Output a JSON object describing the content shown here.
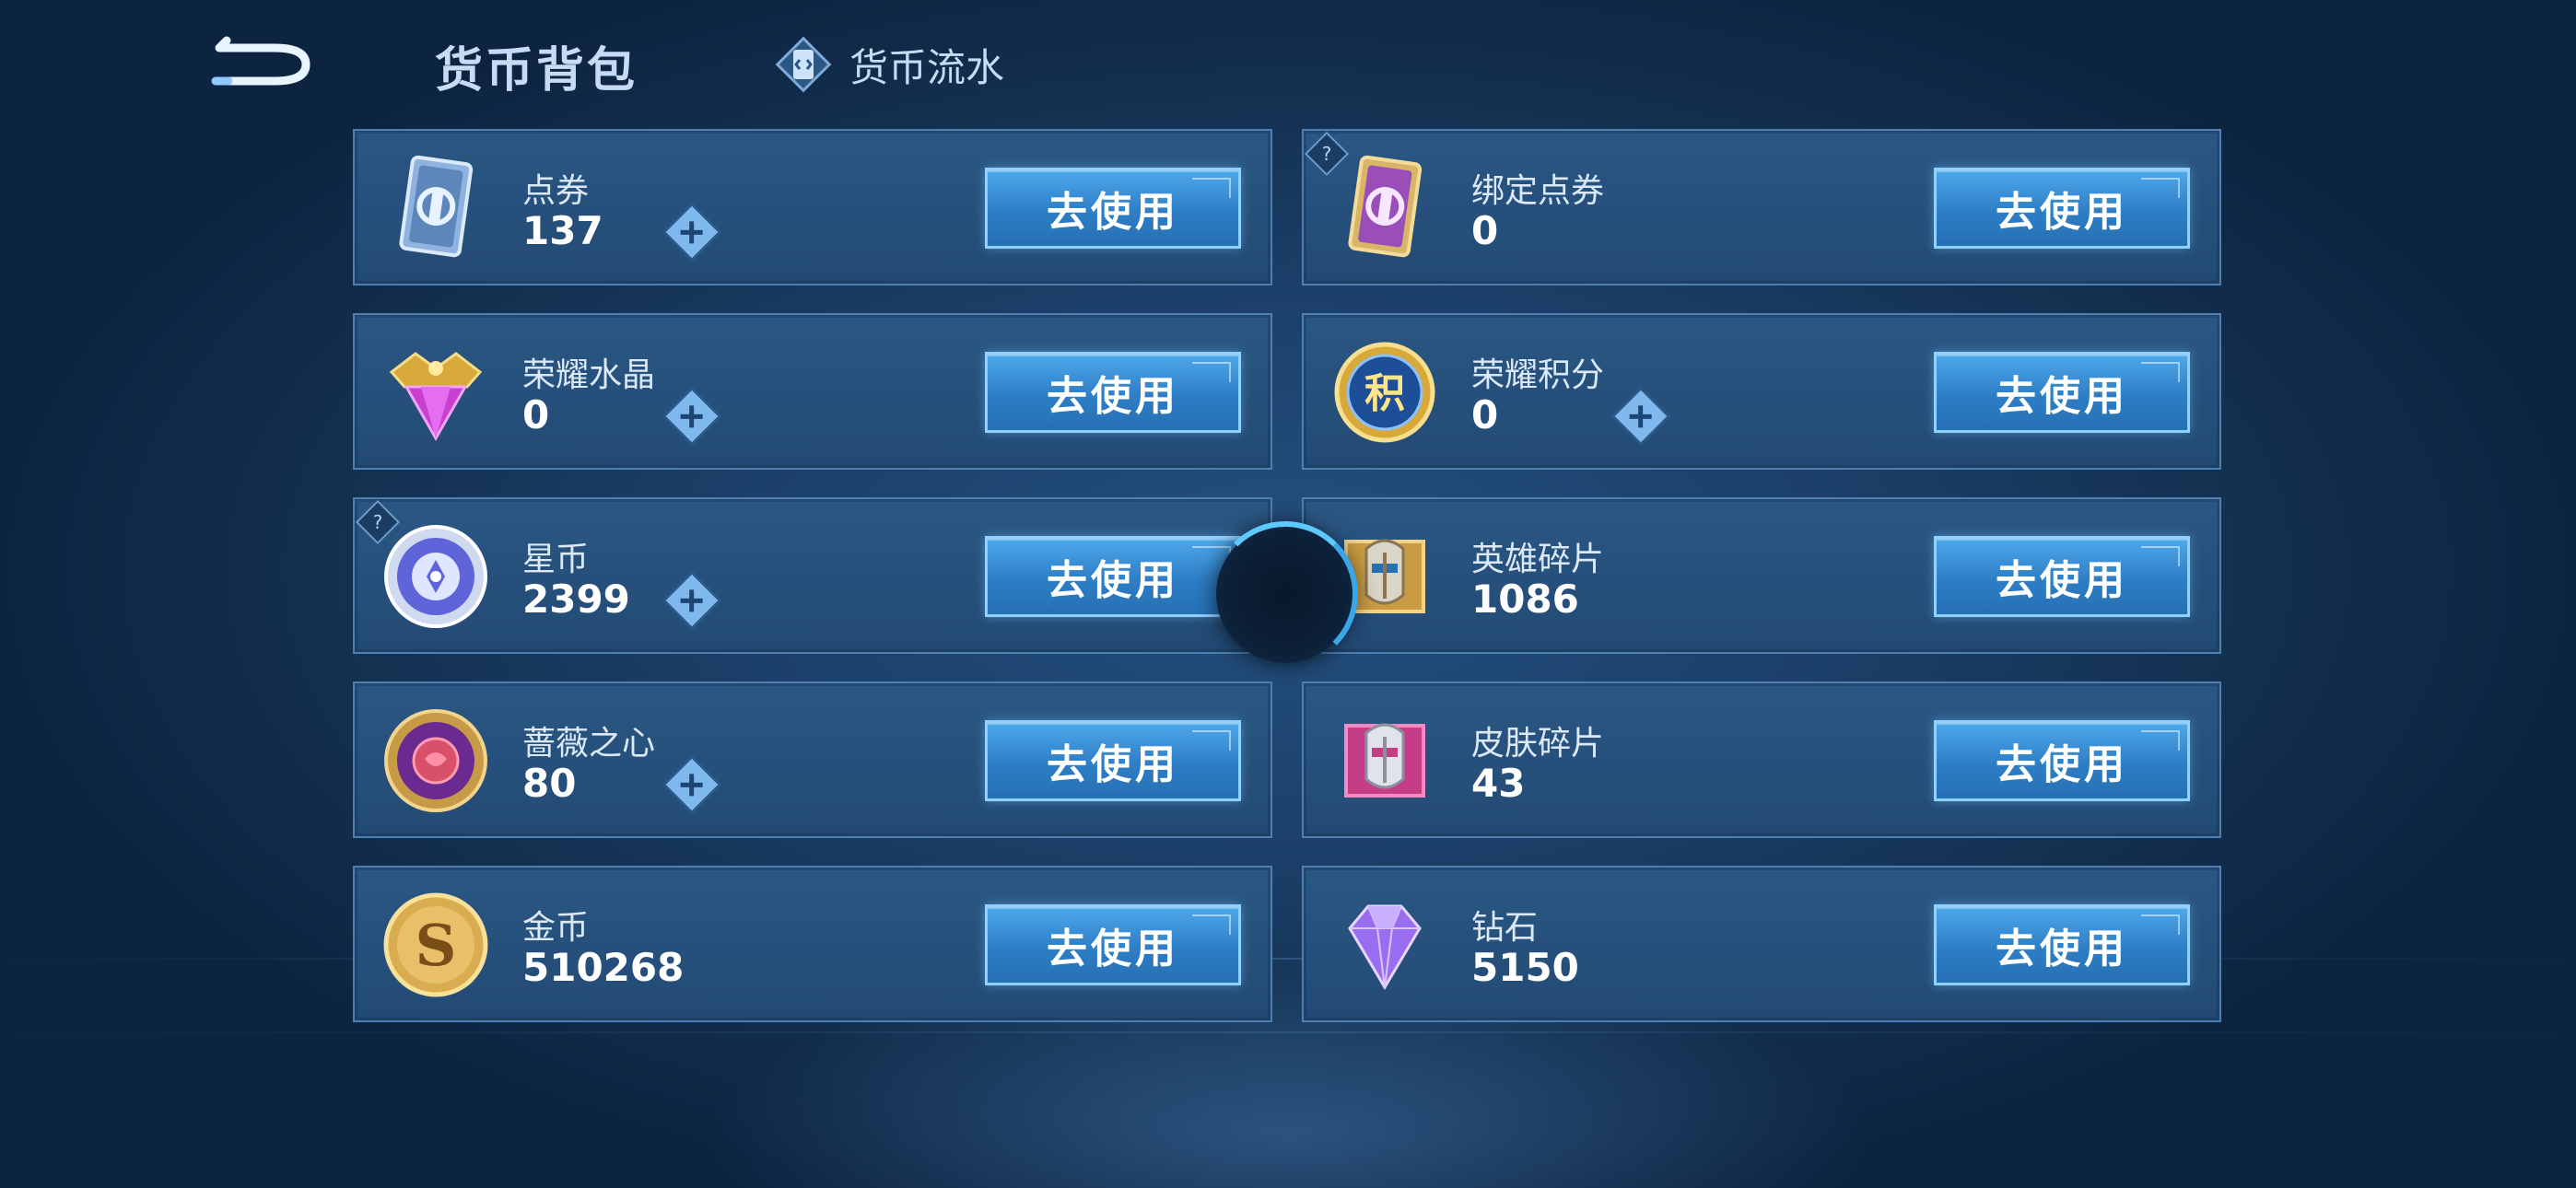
{
  "header": {
    "back_icon": "back-arrow-icon",
    "title": "货币背包",
    "history_tab": {
      "label": "货币流水",
      "icon": "ledger-icon"
    }
  },
  "currencies": [
    {
      "name": "点券",
      "value": "137",
      "icon": "coupon-card-icon",
      "has_add": true,
      "has_help": false,
      "button": "去使用"
    },
    {
      "name": "绑定点券",
      "value": "0",
      "icon": "bound-coupon-card-icon",
      "has_add": false,
      "has_help": true,
      "button": "去使用"
    },
    {
      "name": "荣耀水晶",
      "value": "0",
      "icon": "glory-crystal-icon",
      "has_add": true,
      "has_help": false,
      "button": "去使用"
    },
    {
      "name": "荣耀积分",
      "value": "0",
      "icon": "glory-points-icon",
      "has_add": true,
      "has_help": false,
      "button": "去使用"
    },
    {
      "name": "星币",
      "value": "2399",
      "icon": "star-coin-icon",
      "has_add": true,
      "has_help": true,
      "button": "去使用"
    },
    {
      "name": "英雄碎片",
      "value": "1086",
      "icon": "hero-fragment-icon",
      "has_add": false,
      "has_help": false,
      "button": "去使用"
    },
    {
      "name": "蔷薇之心",
      "value": "80",
      "icon": "rose-heart-icon",
      "has_add": true,
      "has_help": false,
      "button": "去使用"
    },
    {
      "name": "皮肤碎片",
      "value": "43",
      "icon": "skin-fragment-icon",
      "has_add": false,
      "has_help": false,
      "button": "去使用"
    },
    {
      "name": "金币",
      "value": "510268",
      "icon": "gold-coin-icon",
      "has_add": false,
      "has_help": false,
      "button": "去使用"
    },
    {
      "name": "钻石",
      "value": "5150",
      "icon": "diamond-icon",
      "has_add": false,
      "has_help": false,
      "button": "去使用"
    }
  ],
  "help_glyph": "?",
  "colors": {
    "accent": "#3a8fd8",
    "card_bg": "#234b75",
    "card_border": "#4e7fb2",
    "title_text": "#c7dbf2"
  }
}
